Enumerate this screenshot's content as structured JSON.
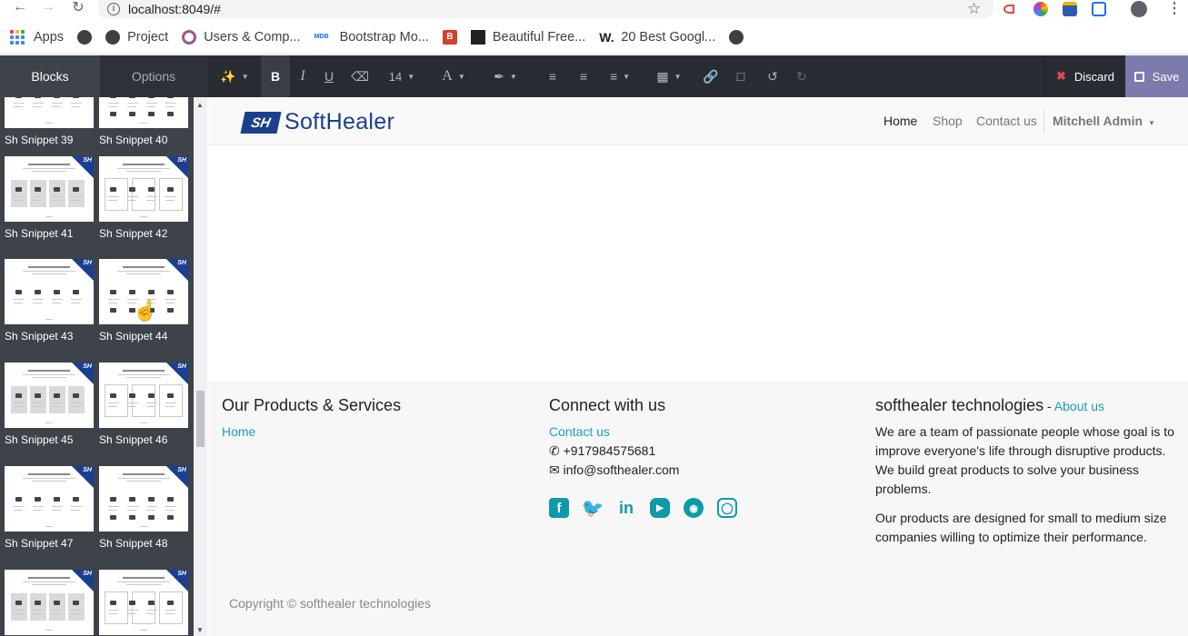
{
  "browser": {
    "url": "localhost:8049/#",
    "bookmarks": [
      {
        "label": "Apps",
        "icon": "apps-icon"
      },
      {
        "label": "",
        "icon": "globe-icon"
      },
      {
        "label": "Project",
        "icon": "globe-icon"
      },
      {
        "label": "Users & Comp...",
        "icon": "odoo-icon"
      },
      {
        "label": "Bootstrap Mo...",
        "icon": "mdb-icon"
      },
      {
        "label": "",
        "icon": "b-icon"
      },
      {
        "label": "Beautiful Free...",
        "icon": "bookmark-icon"
      },
      {
        "label": "20 Best Googl...",
        "icon": "w-icon"
      },
      {
        "label": "",
        "icon": "globe-icon"
      }
    ]
  },
  "editor": {
    "tab_blocks": "Blocks",
    "tab_options": "Options",
    "font_size": "14",
    "discard_label": "Discard",
    "save_label": "Save"
  },
  "snippets": [
    {
      "label": "Sh Snippet 39"
    },
    {
      "label": "Sh Snippet 40"
    },
    {
      "label": "Sh Snippet 41"
    },
    {
      "label": "Sh Snippet 42"
    },
    {
      "label": "Sh Snippet 43"
    },
    {
      "label": "Sh Snippet 44"
    },
    {
      "label": "Sh Snippet 45"
    },
    {
      "label": "Sh Snippet 46"
    },
    {
      "label": "Sh Snippet 47"
    },
    {
      "label": "Sh Snippet 48"
    },
    {
      "label": ""
    },
    {
      "label": ""
    }
  ],
  "site": {
    "logo_text": "SoftHealer",
    "logo_mark": "SH",
    "menu": {
      "home": "Home",
      "shop": "Shop",
      "contact": "Contact us",
      "user": "Mitchell Admin"
    },
    "footer": {
      "col1_title": "Our Products & Services",
      "col1_link": "Home",
      "col2_title": "Connect with us",
      "col2_link": "Contact us",
      "phone": "+917984575681",
      "email": "info@softhealer.com",
      "col3_title": "softhealer technologies",
      "col3_sep": " - ",
      "col3_link": "About us",
      "about_p1": "We are a team of passionate people whose goal is to improve everyone's life through disruptive products. We build great products to solve your business problems.",
      "about_p2": "Our products are designed for small to medium size companies willing to optimize their performance.",
      "copyright": "Copyright © softhealer technologies"
    }
  },
  "colors": {
    "accent": "#17a2b8",
    "brand": "#1b3f8f",
    "save": "#7c7bad",
    "sidebar": "#3e4249",
    "toolbar": "#282b31"
  }
}
